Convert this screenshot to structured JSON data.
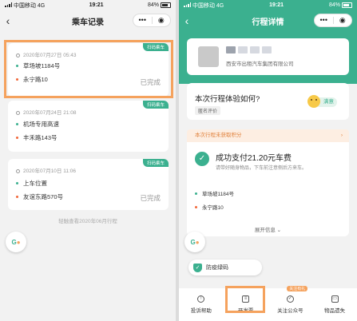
{
  "status_bar": {
    "carrier": "中国移动",
    "network": "4G",
    "time": "19:21",
    "battery": "84%"
  },
  "left": {
    "title": "乘车记录",
    "capsule": {
      "more": "•••",
      "close": "◉"
    },
    "trips": [
      {
        "time": "2020年07月27日 05:43",
        "tag": "扫码乘车",
        "from": "草场坡1184号",
        "to": "永宁路10",
        "status": "已完成"
      },
      {
        "time": "2020年07月24日 21:08",
        "tag": "扫码乘车",
        "from": "机场专用高速",
        "to": "丰禾路143号",
        "status": ""
      },
      {
        "time": "2020年07月10日 11:06",
        "tag": "扫码乘车",
        "from": "上车位置",
        "to": "友谊东路570号",
        "status": "已完成"
      }
    ],
    "footnote": "轻触查看2020年06月行程"
  },
  "right": {
    "title": "行程详情",
    "capsule": {
      "more": "•••",
      "close": "◉"
    },
    "company": "西安市出租汽车集团有限公司",
    "experience": {
      "question": "本次行程体验如何?",
      "anonymous": "匿名评价",
      "rating": "满意"
    },
    "points": "本次行程未获取积分",
    "payment": {
      "title": "成功支付21.20元车费",
      "note": "请带好随身物品，下车前注意侧后方来车。"
    },
    "from": "草场坡1184号",
    "to": "永宁路10",
    "more": "展开信息 ⌄",
    "safety": "防疫绿码",
    "tabs": [
      {
        "label": "投诉帮助",
        "icon": "!"
      },
      {
        "label": "开发票",
        "icon": "≡"
      },
      {
        "label": "关注公众号",
        "icon": "✓",
        "badge": "关注有礼"
      },
      {
        "label": "物品遗失",
        "icon": "▭"
      }
    ]
  },
  "colors": {
    "accent": "#3bb08f",
    "highlight": "#f5a25d"
  }
}
